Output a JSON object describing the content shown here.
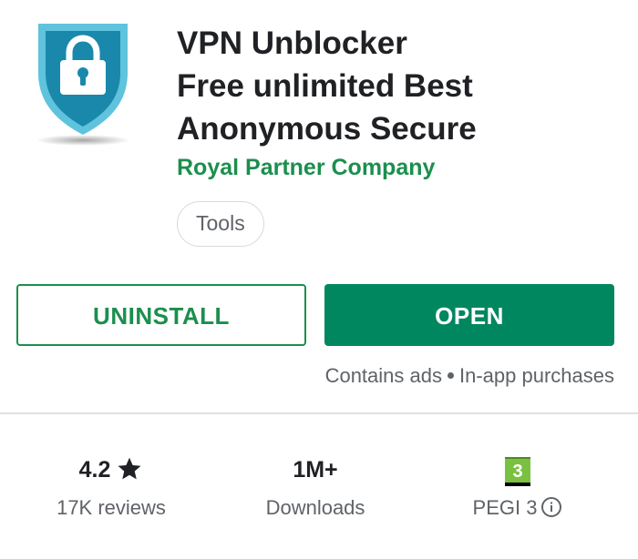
{
  "app": {
    "title_lines": [
      "VPN Unblocker",
      "Free unlimited Best",
      "Anonymous Secure"
    ],
    "developer": "Royal Partner Company",
    "category": "Tools",
    "icon": "shield-lock-icon"
  },
  "actions": {
    "uninstall_label": "UNINSTALL",
    "open_label": "OPEN"
  },
  "notices": {
    "ads": "Contains ads",
    "iap": "In-app purchases"
  },
  "stats": {
    "rating": {
      "value": "4.2",
      "label": "17K reviews",
      "icon": "star-icon"
    },
    "downloads": {
      "value": "1M+",
      "label": "Downloads"
    },
    "content_rating": {
      "badge": "3",
      "label": "PEGI 3",
      "icon": "info-icon"
    }
  },
  "colors": {
    "brand_green": "#01875f",
    "developer_green": "#1b8f4d",
    "shield_blue": "#1b8fb0",
    "pegi_green": "#7ac142"
  }
}
